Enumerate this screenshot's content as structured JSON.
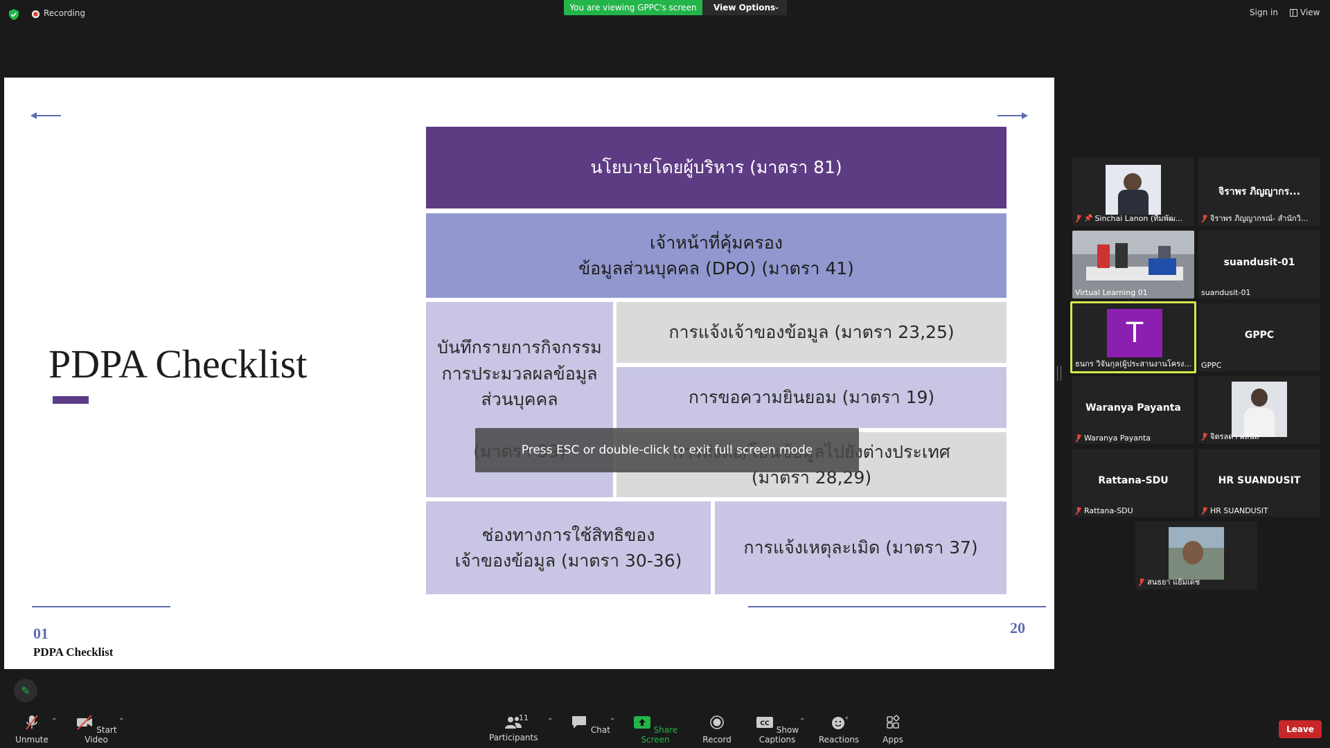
{
  "topbar": {
    "recording_label": "Recording",
    "viewing_banner": "You are viewing GPPC's screen",
    "view_options_label": "View Options",
    "sign_in_label": "Sign in",
    "view_label": "View"
  },
  "slide": {
    "title": "PDPA Checklist",
    "boxes": {
      "policy": "นโยบายโดยผู้บริหาร (มาตรา 81)",
      "dpo": "เจ้าหน้าที่คุ้มครอง\nข้อมูลส่วนบุคคล (DPO) (มาตรา 41)",
      "record": "บันทึกรายการกิจกรรม\nการประมวลผลข้อมูล\nส่วนบุคคล\n\n(มาตรา 39)",
      "notify_owner": "การแจ้งเจ้าของข้อมูล (มาตรา 23,25)",
      "consent": "การขอความยินยอม (มาตรา 19)",
      "transfer": "การส่งต่อ/โอนข้อมูลไปยังต่างประเทศ\n(มาตรา 28,29)",
      "rights": "ช่องทางการใช้สิทธิของ\nเจ้าของข้อมูล (มาตรา 30-36)",
      "breach": "การแจ้งเหตุละเมิด (มาตรา 37)"
    },
    "footer_number": "01",
    "footer_label": "PDPA Checklist",
    "page_number": "20",
    "fullscreen_toast": "Press ESC or double-click to exit full screen mode"
  },
  "participants": [
    {
      "name": "Sinchai Lanon (ทีมพัฒ...",
      "display": "",
      "type": "video"
    },
    {
      "name": "จิราพร ภิญญากรณ์- สำนักวิ...",
      "display": "จิราพร ภิญญากร...",
      "type": "name"
    },
    {
      "name": "Virtual Learning 01",
      "display": "",
      "type": "video"
    },
    {
      "name": "suandusit-01",
      "display": "suandusit-01",
      "type": "name"
    },
    {
      "name": "ธนกร วิจันกุล(ผู้ประสานงานโครง...",
      "display": "T",
      "type": "avatar"
    },
    {
      "name": "GPPC",
      "display": "GPPC",
      "type": "name"
    },
    {
      "name": "Waranya Payanta",
      "display": "Waranya Payanta",
      "type": "name"
    },
    {
      "name": "จิตรลดา ผลนิล",
      "display": "",
      "type": "video"
    },
    {
      "name": "Rattana-SDU",
      "display": "Rattana-SDU",
      "type": "name"
    },
    {
      "name": "HR SUANDUSIT",
      "display": "HR SUANDUSIT",
      "type": "name"
    },
    {
      "name": "สนธยา แย้มเดช",
      "display": "",
      "type": "video"
    }
  ],
  "toolbar": {
    "unmute": "Unmute",
    "start_video": "Start Video",
    "participants": "Participants",
    "participants_count": "11",
    "chat": "Chat",
    "share_screen": "Share Screen",
    "record": "Record",
    "show_captions": "Show Captions",
    "reactions": "Reactions",
    "apps": "Apps",
    "leave": "Leave"
  },
  "colors": {
    "green": "#23b54a",
    "slide_purple": "#5d3c84",
    "slide_blue": "#9298cf",
    "slide_lavender": "#c8c6e4",
    "slide_gray": "#dadada",
    "leave_red": "#c8272a"
  }
}
